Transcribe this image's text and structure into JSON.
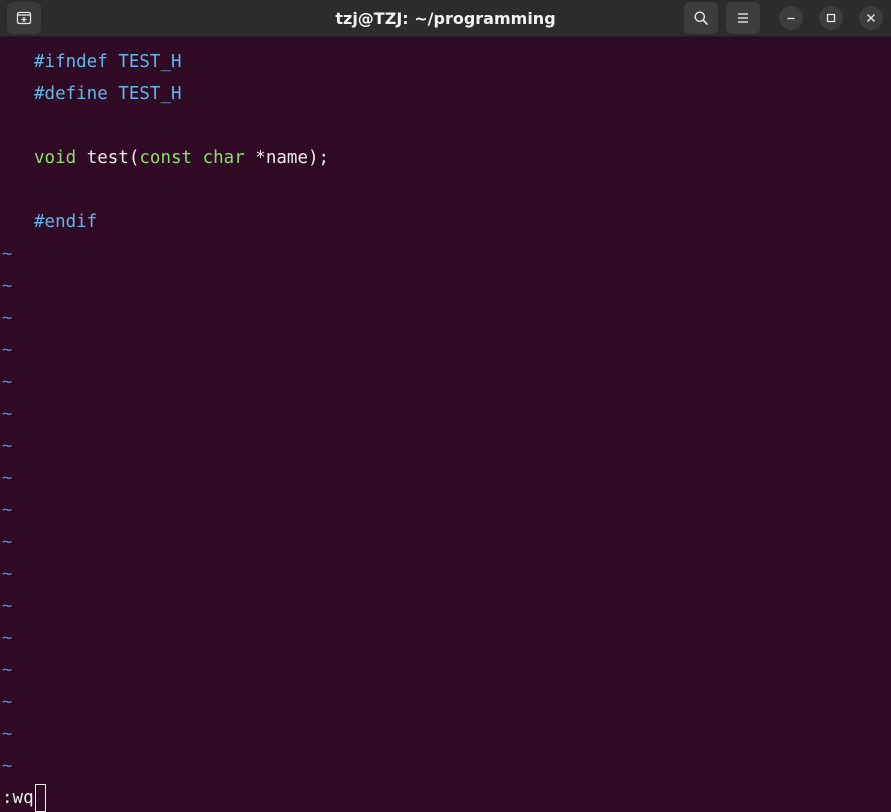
{
  "window": {
    "title": "tzj@TZJ: ~/programming"
  },
  "icons": {
    "new_tab": "new-tab-icon",
    "search": "search-icon",
    "menu": "hamburger-menu-icon",
    "minimize": "minimize-icon",
    "maximize": "maximize-icon",
    "close": "close-icon"
  },
  "colors": {
    "background": "#300a24",
    "titlebar": "#2c2c2c",
    "preprocessor": "#5fb8e8",
    "keyword": "#8ae06a",
    "tilde": "#4f8fd6",
    "text": "#ececec"
  },
  "editor": {
    "lines": {
      "l1": {
        "directive": "#ifndef",
        "rest": " TEST_H"
      },
      "l2": {
        "directive": "#define",
        "rest": " TEST_H"
      },
      "l4": {
        "kw1": "void",
        "part1": " test(",
        "kw2": "const",
        "space": " ",
        "kw3": "char",
        "part2": " *name);"
      },
      "l6": {
        "directive": "#endif"
      }
    },
    "tilde": "~",
    "command": ":wq"
  }
}
